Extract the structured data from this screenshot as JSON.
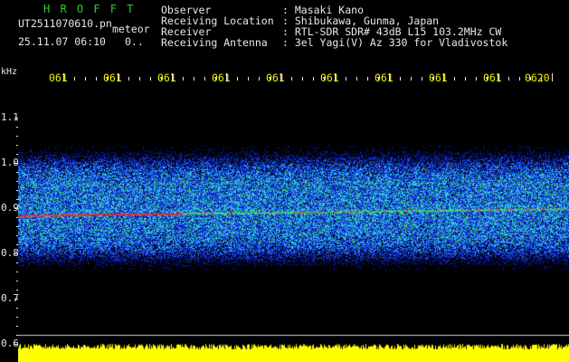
{
  "header": {
    "title": "H R O F F T",
    "filename": "UT2511070610.pn",
    "mode": "meteor",
    "datetime": "25.11.07 06:10",
    "count": "0..",
    "info_rows": [
      {
        "label": "Observer",
        "value": ": Masaki Kano"
      },
      {
        "label": "Receiving Location",
        "value": ": Shibukawa, Gunma, Japan"
      },
      {
        "label": "Receiver",
        "value": ": RTL-SDR SDR# 43dB L15 103.2MHz CW"
      },
      {
        "label": "Receiving Antenna",
        "value": ": 3el Yagi(V) Az 330 for Vladivostok"
      }
    ]
  },
  "freq_axis": {
    "unit": "kHz",
    "labels": [
      "1.1",
      "1.0",
      "0.9",
      "0.8",
      "0.7",
      "0.6"
    ],
    "min": 0.6,
    "max": 1.1
  },
  "time_axis": {
    "labels": [
      "061",
      "061",
      "061",
      "061",
      "061",
      "061",
      "061",
      "061",
      "061",
      "0620"
    ]
  },
  "colors": {
    "label_green": "#34c934",
    "text_white": "#e8e8e8",
    "text_yellow": "#f2f200",
    "noise_dark_blue": "#0b1aa8",
    "noise_blue": "#1f5cff",
    "noise_cyan": "#2fd2ff",
    "noise_green": "#3fe07a",
    "carrier_red": "#ff2a2a",
    "level_yellow": "#ffff00"
  },
  "waterfall": {
    "band_top_khz": 1.03,
    "band_bottom_khz": 0.77,
    "carrier_khz": 0.893,
    "secondary_line_khz": 0.955
  }
}
